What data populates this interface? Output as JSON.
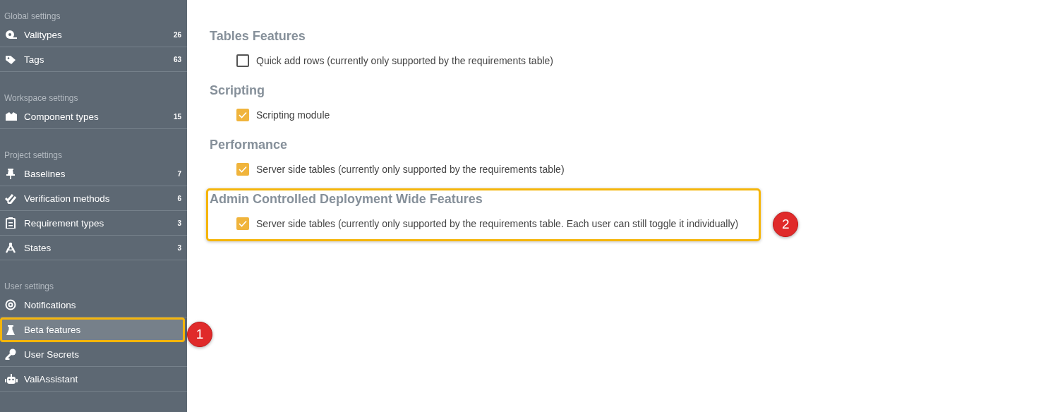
{
  "sidebar": {
    "groups": [
      {
        "title": "Global settings",
        "items": [
          {
            "label": "Valitypes",
            "count": "26",
            "selected": false
          },
          {
            "label": "Tags",
            "count": "63",
            "selected": false
          }
        ]
      },
      {
        "title": "Workspace settings",
        "items": [
          {
            "label": "Component types",
            "count": "15",
            "selected": false
          }
        ]
      },
      {
        "title": "Project settings",
        "items": [
          {
            "label": "Baselines",
            "count": "7",
            "selected": false
          },
          {
            "label": "Verification methods",
            "count": "6",
            "selected": false
          },
          {
            "label": "Requirement types",
            "count": "3",
            "selected": false
          },
          {
            "label": "States",
            "count": "3",
            "selected": false
          }
        ]
      },
      {
        "title": "User settings",
        "items": [
          {
            "label": "Notifications",
            "selected": false
          },
          {
            "label": "Beta features",
            "selected": true,
            "callout": "1"
          },
          {
            "label": "User Secrets",
            "selected": false
          },
          {
            "label": "ValiAssistant",
            "selected": false
          }
        ]
      }
    ]
  },
  "sections": [
    {
      "title": "Tables Features",
      "options": [
        {
          "label": "Quick add rows (currently only supported by the requirements table)",
          "checked": false
        }
      ]
    },
    {
      "title": "Scripting",
      "options": [
        {
          "label": "Scripting module",
          "checked": true
        }
      ]
    },
    {
      "title": "Performance",
      "options": [
        {
          "label": "Server side tables (currently only supported by the requirements table)",
          "checked": true
        }
      ]
    },
    {
      "title": "Admin Controlled Deployment Wide Features",
      "callout": "2",
      "options": [
        {
          "label": "Server side tables (currently only supported by the requirements table. Each user can still toggle it individually)",
          "checked": true
        }
      ]
    }
  ]
}
